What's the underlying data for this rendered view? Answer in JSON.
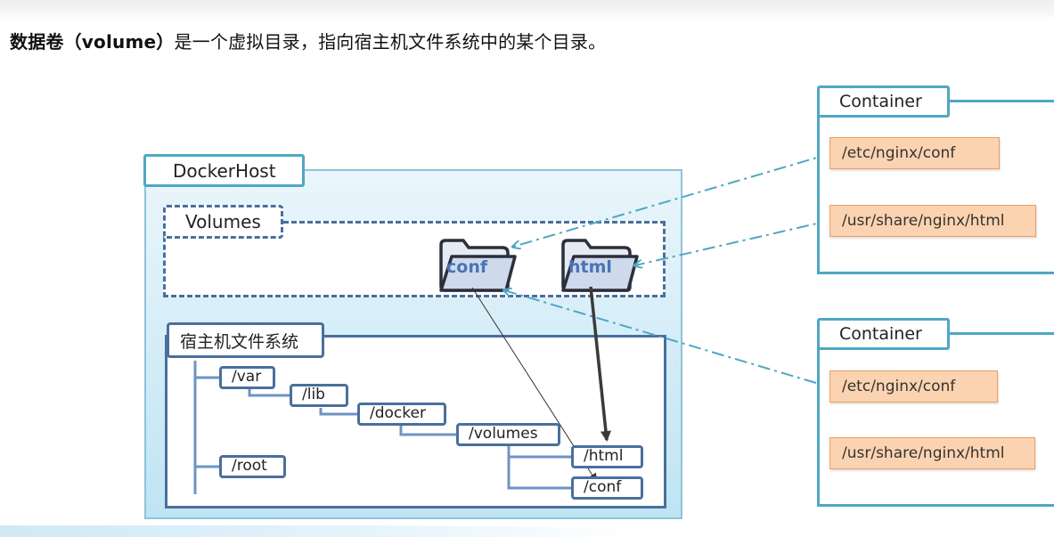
{
  "heading": {
    "bold": "数据卷（volume）",
    "rest": "是一个虚拟目录，指向宿主机文件系统中的某个目录。"
  },
  "docker_host": {
    "label": "DockerHost"
  },
  "volumes": {
    "label": "Volumes",
    "folders": [
      {
        "label": "conf"
      },
      {
        "label": "html"
      }
    ]
  },
  "host_fs": {
    "label": "宿主机文件系统",
    "nodes": [
      {
        "label": "/var"
      },
      {
        "label": "/lib"
      },
      {
        "label": "/docker"
      },
      {
        "label": "/volumes"
      },
      {
        "label": "/html"
      },
      {
        "label": "/conf"
      },
      {
        "label": "/root"
      }
    ]
  },
  "containers": [
    {
      "label": "Container",
      "paths": [
        "/etc/nginx/conf",
        "/usr/share/nginx/html"
      ]
    },
    {
      "label": "Container",
      "paths": [
        "/etc/nginx/conf",
        "/usr/share/nginx/html"
      ]
    }
  ],
  "colors": {
    "host_border": "#4fa7c4",
    "tree_border": "#4a6f9c",
    "path_fill": "#fcd3b0",
    "arrow_dashdot": "#4fa7c4",
    "folder_text": "#4a74b4"
  }
}
